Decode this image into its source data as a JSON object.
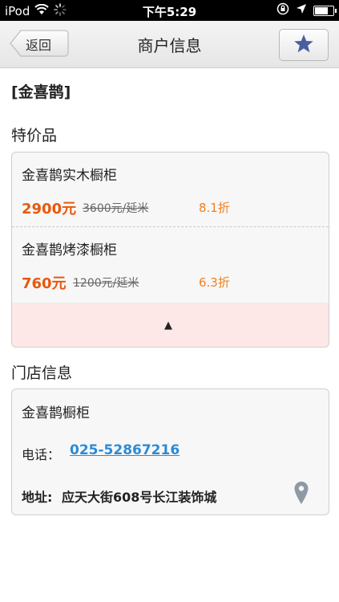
{
  "status_bar": {
    "carrier": "iPod",
    "time": "下午5:29"
  },
  "nav": {
    "back_label": "返回",
    "title": "商户信息"
  },
  "merchant": {
    "name": "[金喜鹊]"
  },
  "specials": {
    "section_title": "特价品",
    "items": [
      {
        "name": "金喜鹊实木橱柜",
        "price": "2900元",
        "original": "3600元/延米",
        "discount": "8.1折"
      },
      {
        "name": "金喜鹊烤漆橱柜",
        "price": "760元",
        "original": "1200元/延米",
        "discount": "6.3折"
      }
    ],
    "collapse_symbol": "▲"
  },
  "store": {
    "section_title": "门店信息",
    "name": "金喜鹊橱柜",
    "phone_label": "电话：",
    "phone": "025-52867216",
    "address_label": "地址:",
    "address": "应天大街608号长江装饰城"
  },
  "colors": {
    "price": "#e8590c",
    "discount": "#f08020",
    "phone_link": "#2a8bd8",
    "collapse_bg": "#fde7e7",
    "star": "#4a5fa0"
  }
}
